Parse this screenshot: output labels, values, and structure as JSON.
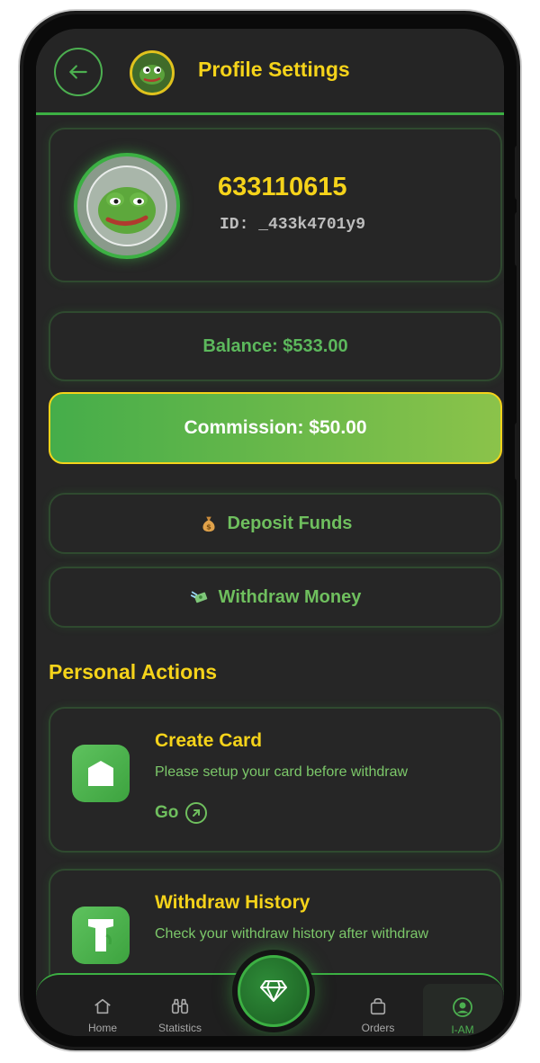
{
  "header": {
    "title": "Profile Settings",
    "back_icon": "arrow-left-icon",
    "avatar_icon": "pepe-coin-icon"
  },
  "profile": {
    "username": "633110615",
    "user_id": "ID: _433k4701y9",
    "avatar_icon": "pepe-coin-avatar"
  },
  "balance": {
    "label": "Balance: $533.00"
  },
  "commission": {
    "label": "Commission: $50.00"
  },
  "actions": {
    "deposit": {
      "label": "Deposit Funds",
      "icon": "money-bag-icon"
    },
    "withdraw": {
      "label": "Withdraw Money",
      "icon": "flying-money-icon"
    }
  },
  "personal_actions": {
    "title": "Personal Actions",
    "items": [
      {
        "title": "Create Card",
        "description": "Please setup your card before withdraw",
        "link": "Go",
        "icon": "card-icon"
      },
      {
        "title": "Withdraw History",
        "description": "Check your withdraw history after withdraw",
        "icon": "history-icon"
      }
    ]
  },
  "nav": {
    "items": [
      {
        "label": "Home",
        "icon": "home-icon"
      },
      {
        "label": "Statistics",
        "icon": "binoculars-icon"
      },
      {
        "label": "Orders",
        "icon": "bag-icon"
      },
      {
        "label": "I-AM",
        "icon": "user-circle-icon"
      }
    ],
    "center_icon": "diamond-icon",
    "active": "I-AM"
  },
  "colors": {
    "accent_yellow": "#f5d31a",
    "accent_green": "#3cb043",
    "background": "#262626"
  }
}
